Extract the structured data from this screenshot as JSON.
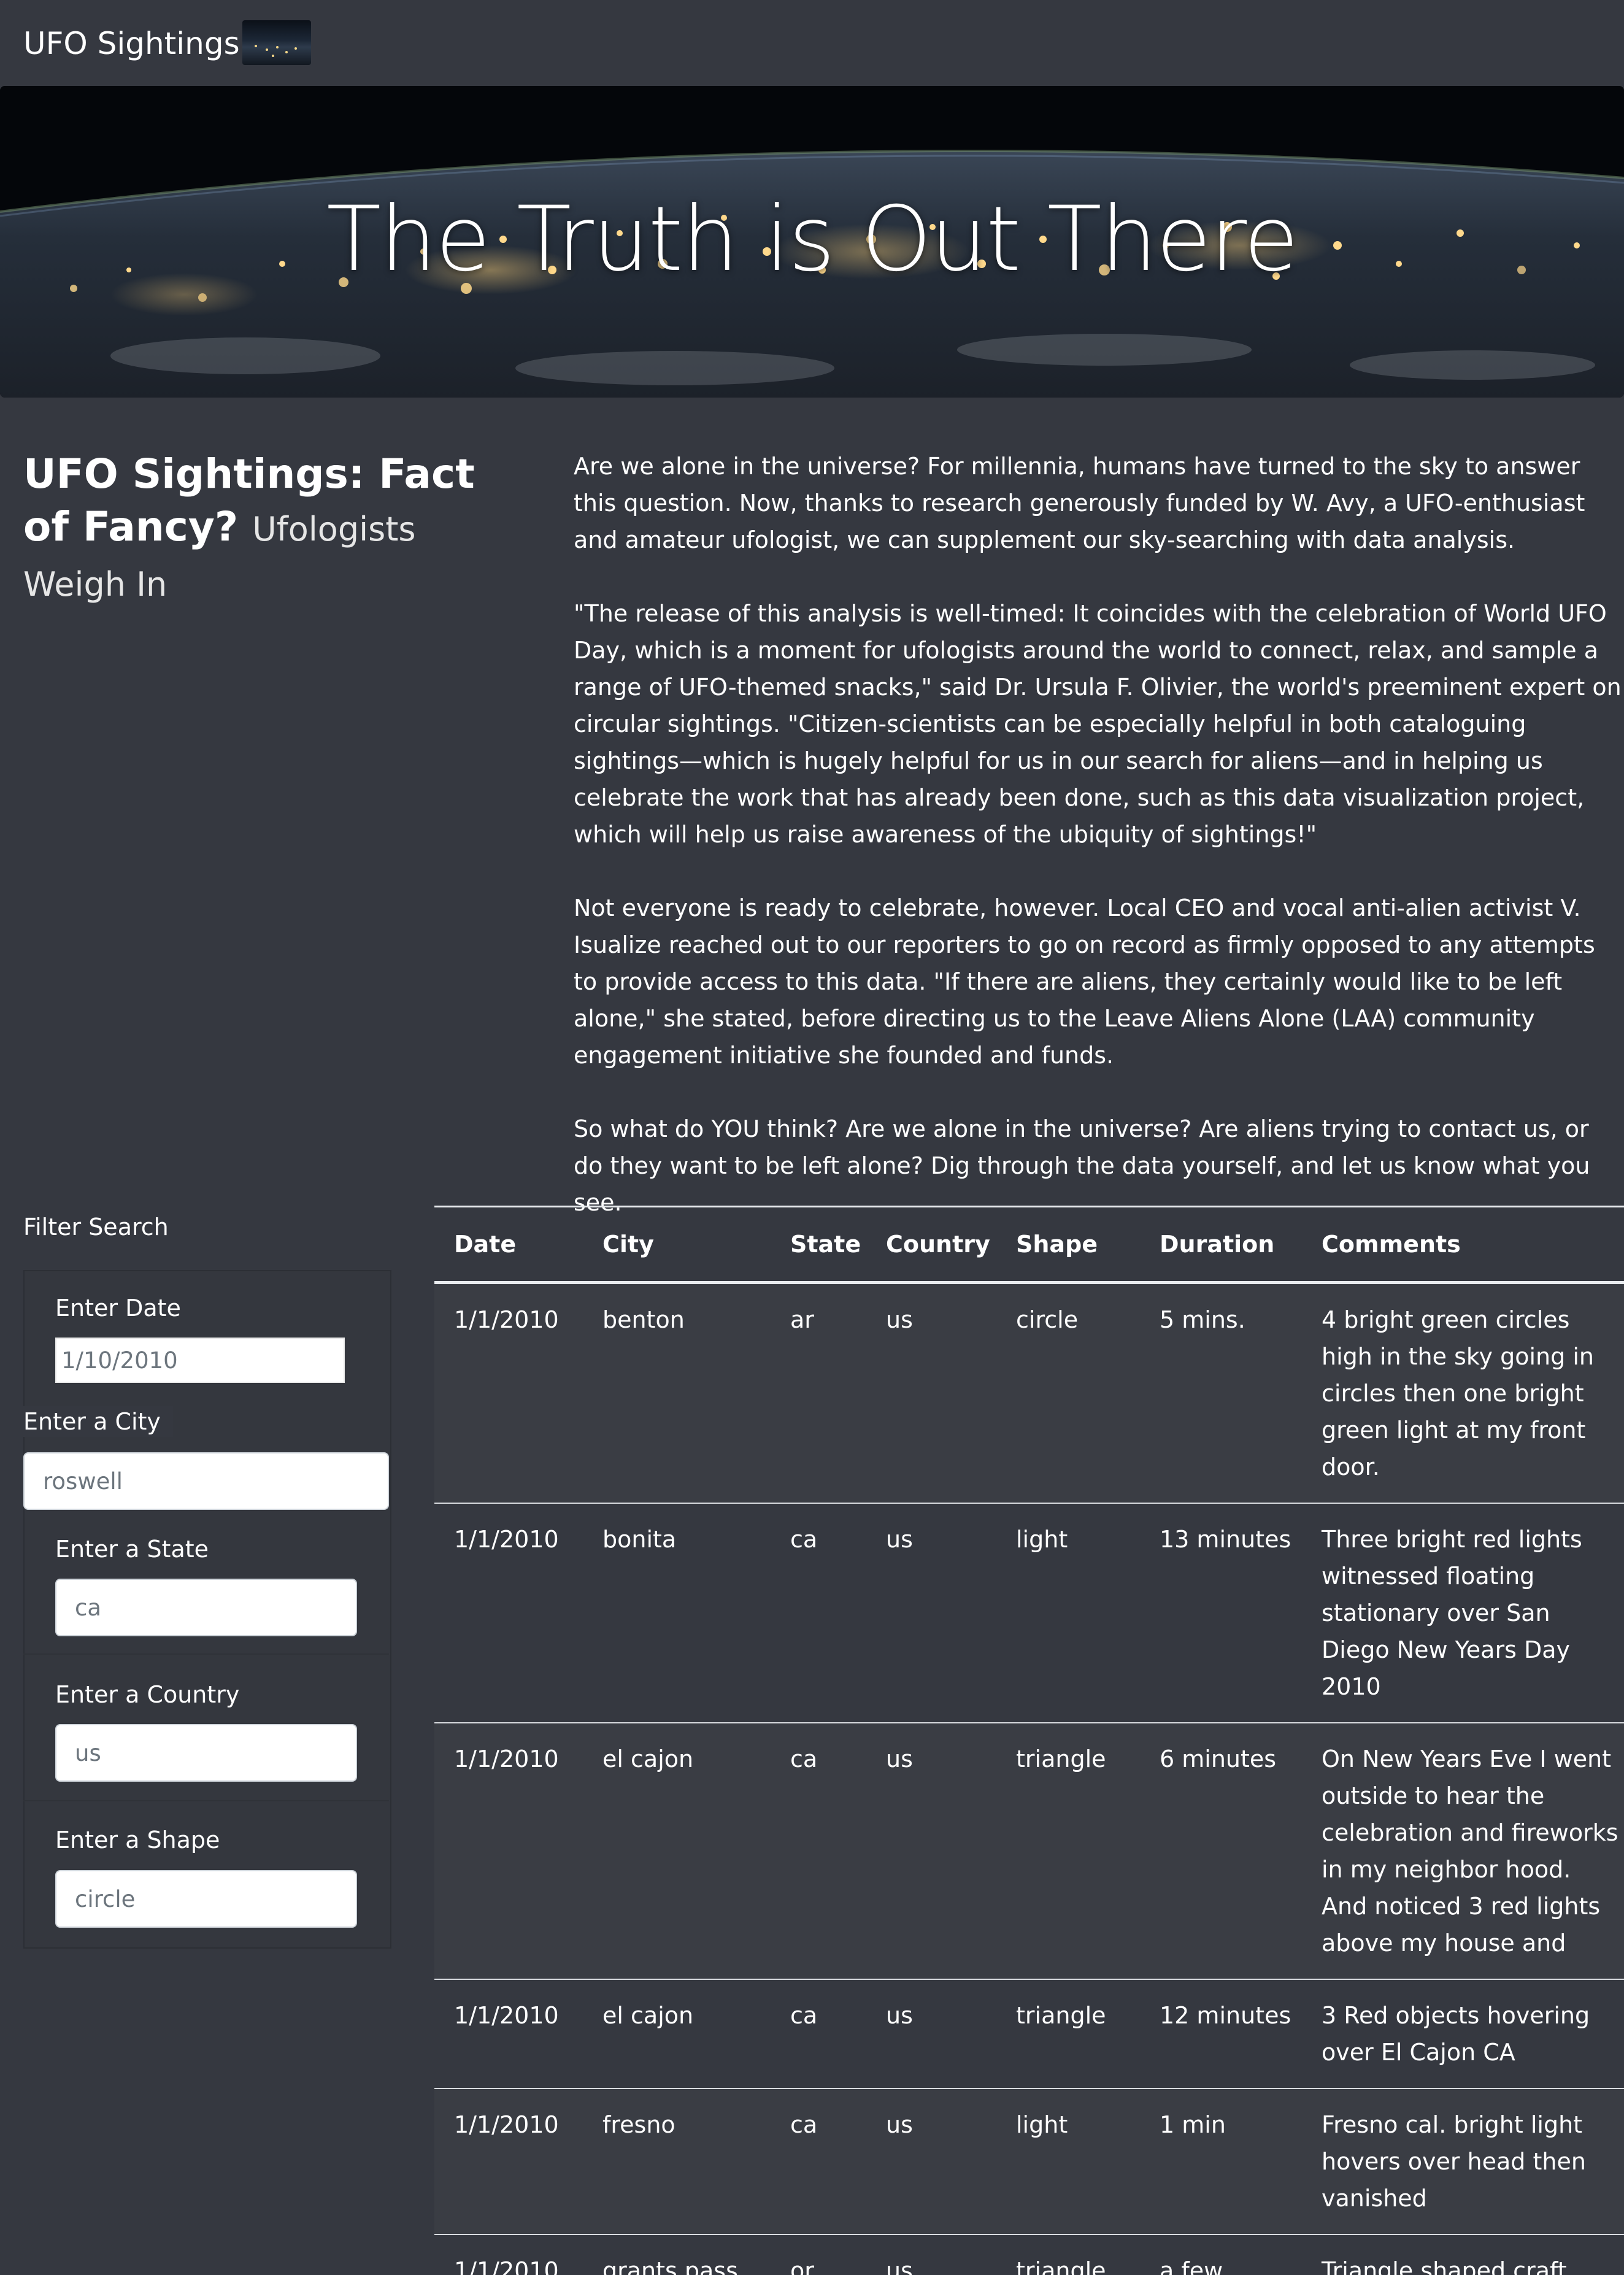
{
  "navbar": {
    "brand": "UFO Sightings",
    "thumb_icon": "earth-night-thumbnail"
  },
  "hero": {
    "title": "The Truth is Out There"
  },
  "article": {
    "heading": "UFO Sightings: Fact of Fancy?",
    "subheading": "Ufologists Weigh In",
    "paragraphs": [
      "Are we alone in the universe? For millennia, humans have turned to the sky to answer this question. Now, thanks to research generously funded by W. Avy, a UFO-enthusiast and amateur ufologist, we can supplement our sky-searching with data analysis.",
      "\"The release of this analysis is well-timed: It coincides with the celebration of World UFO Day, which is a moment for ufologists around the world to connect, relax, and sample a range of UFO-themed snacks,\" said Dr. Ursula F. Olivier, the world's preeminent expert on circular sightings. \"Citizen-scientists can be especially helpful in both cataloguing sightings—which is hugely helpful for us in our search for aliens—and in helping us celebrate the work that has already been done, such as this data visualization project, which will help us raise awareness of the ubiquity of sightings!\"",
      "Not everyone is ready to celebrate, however. Local CEO and vocal anti-alien activist V. Isualize reached out to our reporters to go on record as firmly opposed to any attempts to provide access to this data. \"If there are aliens, they certainly would like to be left alone,\" she stated, before directing us to the Leave Aliens Alone (LAA) community engagement initiative she founded and funds.",
      "So what do YOU think? Are we alone in the universe? Are aliens trying to contact us, or do they want to be left alone? Dig through the data yourself, and let us know what you see."
    ]
  },
  "filters": {
    "title": "Filter Search",
    "date": {
      "label": "Enter Date",
      "placeholder": "1/10/2010"
    },
    "city": {
      "label": "Enter a City",
      "placeholder": "roswell"
    },
    "state": {
      "label": "Enter a State",
      "placeholder": "ca"
    },
    "country": {
      "label": "Enter a Country",
      "placeholder": "us"
    },
    "shape": {
      "label": "Enter a Shape",
      "placeholder": "circle"
    }
  },
  "table": {
    "headers": [
      "Date",
      "City",
      "State",
      "Country",
      "Shape",
      "Duration",
      "Comments"
    ],
    "rows": [
      [
        "1/1/2010",
        "benton",
        "ar",
        "us",
        "circle",
        "5 mins.",
        "4 bright green circles high in the sky going in circles then one bright green light at my front door."
      ],
      [
        "1/1/2010",
        "bonita",
        "ca",
        "us",
        "light",
        "13 minutes",
        "Three bright red lights witnessed floating stationary over San Diego New Years Day 2010"
      ],
      [
        "1/1/2010",
        "el cajon",
        "ca",
        "us",
        "triangle",
        "6 minutes",
        "On New Years Eve I went outside to hear the celebration and fireworks in my neighbor hood. And noticed 3 red lights above my house and"
      ],
      [
        "1/1/2010",
        "el cajon",
        "ca",
        "us",
        "triangle",
        "12 minutes",
        "3 Red objects hovering over El Cajon CA"
      ],
      [
        "1/1/2010",
        "fresno",
        "ca",
        "us",
        "light",
        "1 min",
        "Fresno cal. bright light hovers over head then vanished"
      ],
      [
        "1/1/2010",
        "grants pass",
        "or",
        "us",
        "triangle",
        "a few mintues",
        "Triangle shaped craft with three red lights at points"
      ]
    ]
  }
}
